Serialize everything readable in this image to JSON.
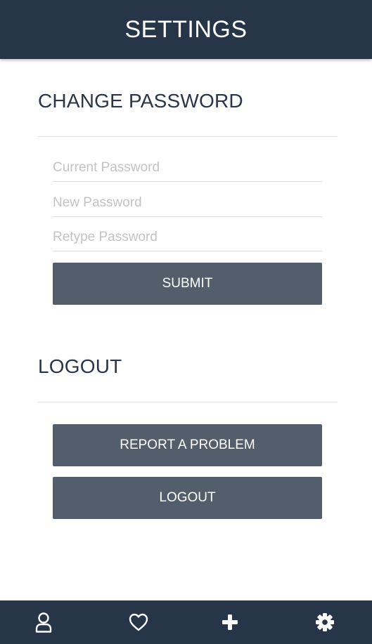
{
  "header": {
    "title": "SETTINGS"
  },
  "change_password": {
    "title": "CHANGE PASSWORD",
    "fields": [
      {
        "placeholder": "Current Password",
        "value": ""
      },
      {
        "placeholder": "New Password",
        "value": ""
      },
      {
        "placeholder": "Retype Password",
        "value": ""
      }
    ],
    "submit_label": "SUBMIT"
  },
  "logout_section": {
    "title": "LOGOUT",
    "report_label": "REPORT A PROBLEM",
    "logout_label": "LOGOUT"
  },
  "tabbar": {
    "items": [
      {
        "icon": "user-icon"
      },
      {
        "icon": "heart-icon"
      },
      {
        "icon": "plus-icon"
      },
      {
        "icon": "gear-icon"
      }
    ]
  },
  "colors": {
    "header_bg": "#263547",
    "button_bg": "#525e6c",
    "title_text": "#2a3647",
    "placeholder": "#c3c3c3"
  }
}
